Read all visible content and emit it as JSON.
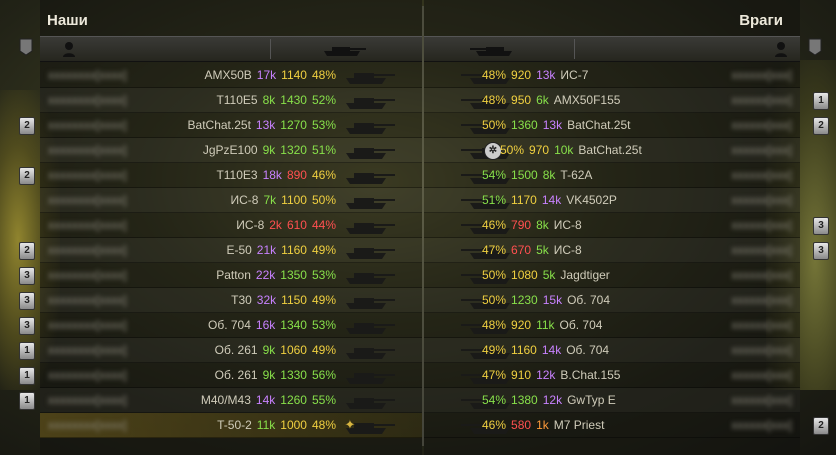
{
  "teams": {
    "left": "Наши",
    "right": "Враги"
  },
  "icons": {
    "person": "person-icon",
    "tank": "tank-icon",
    "flag": "flag-icon",
    "badge": "mastery-badge-icon",
    "achievement": "achievement-icon",
    "platoon": "platoon-icon"
  },
  "left_rows": [
    {
      "tank": "AMX50B",
      "battles": "17k",
      "rating": "1140",
      "winrate": "48%",
      "bc": "purple",
      "rc": "yellow",
      "wc": "yellow",
      "badge": ""
    },
    {
      "tank": "T110E5",
      "battles": "8k",
      "rating": "1430",
      "winrate": "52%",
      "bc": "green",
      "rc": "green",
      "wc": "green",
      "badge": ""
    },
    {
      "tank": "BatChat.25t",
      "battles": "13k",
      "rating": "1270",
      "winrate": "53%",
      "bc": "purple",
      "rc": "green",
      "wc": "green",
      "badge": "2"
    },
    {
      "tank": "JgPzE100",
      "battles": "9k",
      "rating": "1320",
      "winrate": "51%",
      "bc": "green",
      "rc": "green",
      "wc": "green",
      "badge": ""
    },
    {
      "tank": "T110E3",
      "battles": "18k",
      "rating": "890",
      "winrate": "46%",
      "bc": "purple",
      "rc": "red",
      "wc": "yellow",
      "badge": "2"
    },
    {
      "tank": "ИС-8",
      "battles": "7k",
      "rating": "1100",
      "winrate": "50%",
      "bc": "green",
      "rc": "yellow",
      "wc": "yellow",
      "badge": ""
    },
    {
      "tank": "ИС-8",
      "battles": "2k",
      "rating": "610",
      "winrate": "44%",
      "bc": "red",
      "rc": "red",
      "wc": "red",
      "badge": ""
    },
    {
      "tank": "E-50",
      "battles": "21k",
      "rating": "1160",
      "winrate": "49%",
      "bc": "purple",
      "rc": "yellow",
      "wc": "yellow",
      "badge": "2"
    },
    {
      "tank": "Patton",
      "battles": "22k",
      "rating": "1350",
      "winrate": "53%",
      "bc": "purple",
      "rc": "green",
      "wc": "green",
      "badge": "3"
    },
    {
      "tank": "T30",
      "battles": "32k",
      "rating": "1150",
      "winrate": "49%",
      "bc": "purple",
      "rc": "yellow",
      "wc": "yellow",
      "badge": "3"
    },
    {
      "tank": "Об. 704",
      "battles": "16k",
      "rating": "1340",
      "winrate": "53%",
      "bc": "purple",
      "rc": "green",
      "wc": "green",
      "badge": "3"
    },
    {
      "tank": "Об. 261",
      "battles": "9k",
      "rating": "1060",
      "winrate": "49%",
      "bc": "green",
      "rc": "yellow",
      "wc": "yellow",
      "badge": "1"
    },
    {
      "tank": "Об. 261",
      "battles": "9k",
      "rating": "1330",
      "winrate": "56%",
      "bc": "green",
      "rc": "green",
      "wc": "green",
      "badge": "1"
    },
    {
      "tank": "M40/M43",
      "battles": "14k",
      "rating": "1260",
      "winrate": "55%",
      "bc": "purple",
      "rc": "green",
      "wc": "green",
      "badge": "1"
    },
    {
      "tank": "T-50-2",
      "battles": "11k",
      "rating": "1000",
      "winrate": "48%",
      "bc": "green",
      "rc": "yellow",
      "wc": "yellow",
      "badge": ""
    }
  ],
  "right_rows": [
    {
      "winrate": "48%",
      "rating": "920",
      "battles": "13k",
      "tank": "ИС-7",
      "wc": "yellow",
      "rc": "yellow",
      "bc": "purple",
      "badge": ""
    },
    {
      "winrate": "48%",
      "rating": "950",
      "battles": "6k",
      "tank": "AMX50F155",
      "wc": "yellow",
      "rc": "yellow",
      "bc": "green",
      "badge": "1"
    },
    {
      "winrate": "50%",
      "rating": "1360",
      "battles": "13k",
      "tank": "BatChat.25t",
      "wc": "yellow",
      "rc": "green",
      "bc": "purple",
      "badge": "2"
    },
    {
      "winrate": "50%",
      "rating": "970",
      "battles": "10k",
      "tank": "BatChat.25t",
      "wc": "yellow",
      "rc": "yellow",
      "bc": "green",
      "badge": ""
    },
    {
      "winrate": "54%",
      "rating": "1500",
      "battles": "8k",
      "tank": "T-62A",
      "wc": "green",
      "rc": "green",
      "bc": "green",
      "badge": ""
    },
    {
      "winrate": "51%",
      "rating": "1170",
      "battles": "14k",
      "tank": "VK4502P",
      "wc": "green",
      "rc": "yellow",
      "bc": "purple",
      "badge": ""
    },
    {
      "winrate": "46%",
      "rating": "790",
      "battles": "8k",
      "tank": "ИС-8",
      "wc": "yellow",
      "rc": "red",
      "bc": "green",
      "badge": "3"
    },
    {
      "winrate": "47%",
      "rating": "670",
      "battles": "5k",
      "tank": "ИС-8",
      "wc": "yellow",
      "rc": "red",
      "bc": "green",
      "badge": "3"
    },
    {
      "winrate": "50%",
      "rating": "1080",
      "battles": "5k",
      "tank": "Jagdtiger",
      "wc": "yellow",
      "rc": "yellow",
      "bc": "green",
      "badge": ""
    },
    {
      "winrate": "50%",
      "rating": "1230",
      "battles": "15k",
      "tank": "Об. 704",
      "wc": "yellow",
      "rc": "green",
      "bc": "purple",
      "badge": ""
    },
    {
      "winrate": "48%",
      "rating": "920",
      "battles": "11k",
      "tank": "Об. 704",
      "wc": "yellow",
      "rc": "yellow",
      "bc": "green",
      "badge": ""
    },
    {
      "winrate": "49%",
      "rating": "1160",
      "battles": "14k",
      "tank": "Об. 704",
      "wc": "yellow",
      "rc": "yellow",
      "bc": "purple",
      "badge": ""
    },
    {
      "winrate": "47%",
      "rating": "910",
      "battles": "12k",
      "tank": "B.Chat.155",
      "wc": "yellow",
      "rc": "yellow",
      "bc": "purple",
      "badge": ""
    },
    {
      "winrate": "54%",
      "rating": "1380",
      "battles": "12k",
      "tank": "GwTyp E",
      "wc": "green",
      "rc": "green",
      "bc": "purple",
      "badge": ""
    },
    {
      "winrate": "46%",
      "rating": "580",
      "battles": "1k",
      "tank": "M7 Priest",
      "wc": "yellow",
      "rc": "red",
      "bc": "orange",
      "badge": "2"
    }
  ]
}
